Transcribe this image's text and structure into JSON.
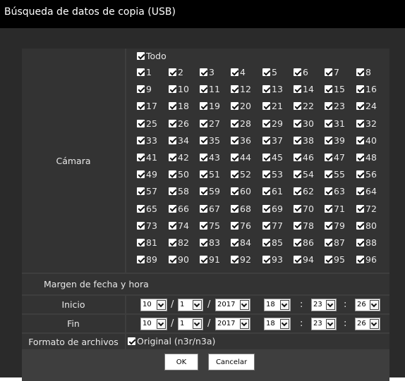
{
  "window": {
    "title": "Búsqueda de datos de copia (USB)"
  },
  "camera": {
    "label": "Cámara",
    "all_label": "Todo",
    "all_checked": true,
    "numbers": [
      "1",
      "2",
      "3",
      "4",
      "5",
      "6",
      "7",
      "8",
      "9",
      "10",
      "11",
      "12",
      "13",
      "14",
      "15",
      "16",
      "17",
      "18",
      "19",
      "20",
      "21",
      "22",
      "23",
      "24",
      "25",
      "26",
      "27",
      "28",
      "29",
      "30",
      "31",
      "32",
      "33",
      "34",
      "35",
      "36",
      "37",
      "38",
      "39",
      "40",
      "41",
      "42",
      "43",
      "44",
      "45",
      "46",
      "47",
      "48",
      "49",
      "50",
      "51",
      "52",
      "53",
      "54",
      "55",
      "56",
      "57",
      "58",
      "59",
      "60",
      "61",
      "62",
      "63",
      "64",
      "65",
      "66",
      "67",
      "68",
      "69",
      "70",
      "71",
      "72",
      "73",
      "74",
      "75",
      "76",
      "77",
      "78",
      "79",
      "80",
      "81",
      "82",
      "83",
      "84",
      "85",
      "86",
      "87",
      "88",
      "89",
      "90",
      "91",
      "92",
      "93",
      "94",
      "95",
      "96"
    ]
  },
  "date_range": {
    "label": "Margen de fecha y hora",
    "start": {
      "label": "Inicio",
      "day": "10",
      "month": "1",
      "year": "2017",
      "hour": "18",
      "minute": "23",
      "second": "26"
    },
    "end": {
      "label": "Fin",
      "day": "10",
      "month": "1",
      "year": "2017",
      "hour": "18",
      "minute": "23",
      "second": "26"
    },
    "date_sep": "/",
    "time_sep": ":"
  },
  "file_format": {
    "label": "Formato de archivos",
    "option": "Original (n3r/n3a)",
    "checked": true
  },
  "buttons": {
    "ok": "OK",
    "cancel": "Cancelar"
  }
}
